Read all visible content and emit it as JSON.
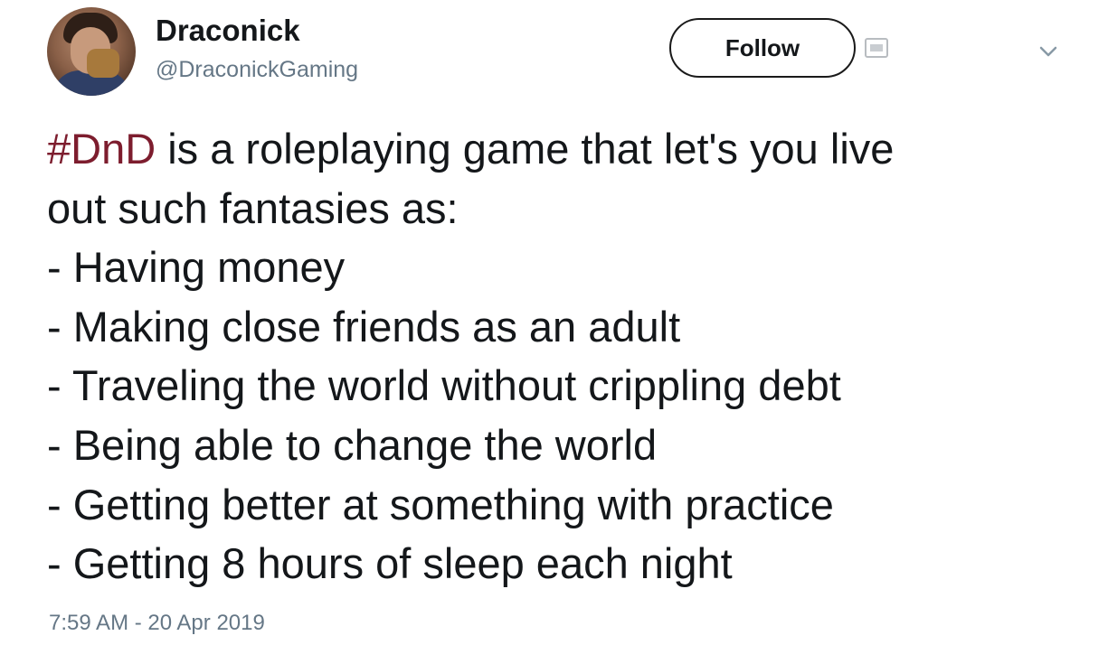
{
  "author": {
    "display_name": "Draconick",
    "handle": "@DraconickGaming"
  },
  "follow_button": {
    "label": "Follow"
  },
  "tweet": {
    "hashtag": "#DnD",
    "first_line_rest": " is a roleplaying game that let's you live",
    "lines": [
      "out such fantasies as:",
      "- Having money",
      "- Making close friends as an adult",
      "- Traveling the world without crippling debt",
      "- Being able to change the world",
      "- Getting better at something with practice",
      "- Getting 8 hours of sleep each night"
    ]
  },
  "timestamp": "7:59 AM - 20 Apr 2019",
  "colors": {
    "hashtag": "#7d1d2e",
    "text": "#14171a",
    "muted": "#657786"
  },
  "icons": {
    "avatar": "profile-photo",
    "extra": "card-icon",
    "menu": "chevron-down-icon"
  }
}
